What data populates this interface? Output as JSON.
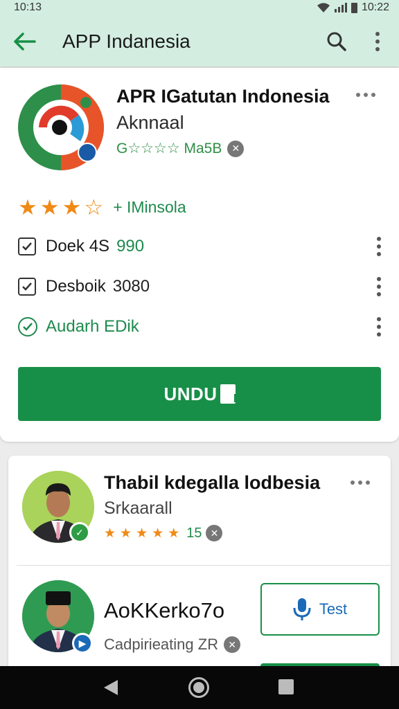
{
  "status_bar": {
    "time": "10:13",
    "battery": "10:22"
  },
  "app_bar": {
    "title": "APP Indanesia"
  },
  "app": {
    "title": "APR IGatutan Indonesia",
    "developer": "Aknnaal",
    "meta": "G☆☆☆☆ Ma5B",
    "rating_text": "+ IMinsola",
    "install_label": "UNDU"
  },
  "options": [
    {
      "label": "Doek 4S",
      "value": "990"
    },
    {
      "label": "Desboik",
      "value": "3080"
    },
    {
      "label": "Audarh EDik",
      "value": ""
    }
  ],
  "listing": [
    {
      "title": "Thabil kdegalla lodbesia",
      "subtitle": "Srkaarall",
      "count": "15"
    },
    {
      "title": "AoKKerko7o",
      "subtitle": "Cadpirieating ZR",
      "action_label": "Test"
    }
  ],
  "colors": {
    "brand_green": "#188f48",
    "app_bar_bg": "#d3eee1",
    "star_orange": "#f08a16",
    "accent_blue": "#1a6ab7"
  }
}
